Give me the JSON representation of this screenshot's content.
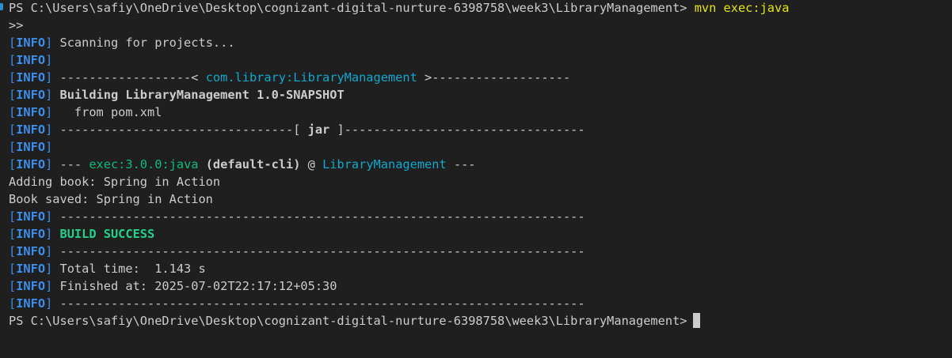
{
  "terminal": {
    "prompt": "PS C:\\Users\\safiy\\OneDrive\\Desktop\\cognizant-digital-nurture-6398758\\week3\\LibraryManagement>",
    "command": "mvn exec:java",
    "continuation": ">>",
    "info_label": "INFO",
    "scanning": "Scanning for projects...",
    "artifact_left": "------------------< ",
    "artifact_id": "com.library:LibraryManagement",
    "artifact_right": " >-------------------",
    "building": "Building LibraryManagement 1.0-SNAPSHOT",
    "from_pom": "  from pom.xml",
    "jar_left": "--------------------------------[ ",
    "jar_label": "jar",
    "jar_right": " ]---------------------------------",
    "exec_prefix": "--- ",
    "exec_plugin": "exec:3.0.0:java",
    "exec_id": "(default-cli)",
    "exec_at": " @ ",
    "exec_project": "LibraryManagement",
    "exec_suffix": " ---",
    "adding_book": "Adding book: Spring in Action",
    "book_saved": "Book saved: Spring in Action",
    "separator": "------------------------------------------------------------------------",
    "build_success": "BUILD SUCCESS",
    "total_time": "Total time:  1.143 s",
    "finished_at": "Finished at: 2025-07-02T22:17:12+05:30"
  },
  "colors": {
    "background": "#1f1f1f",
    "foreground": "#cccccc",
    "info_blue": "#3b8eea",
    "command_yellow": "#e5e510",
    "artifact_cyan": "#11a8cd",
    "plugin_green": "#0dbc79",
    "success_green": "#23d18b"
  }
}
